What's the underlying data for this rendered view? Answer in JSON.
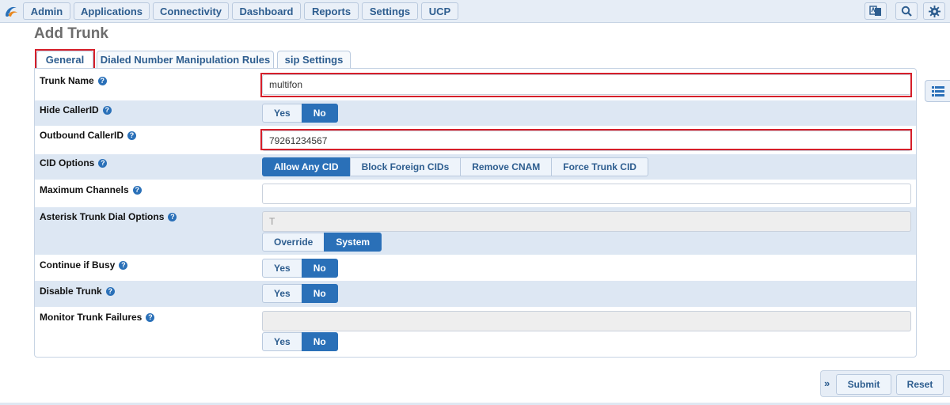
{
  "nav": {
    "items": [
      "Admin",
      "Applications",
      "Connectivity",
      "Dashboard",
      "Reports",
      "Settings",
      "UCP"
    ]
  },
  "page": {
    "title": "Add Trunk"
  },
  "tabs": [
    "General",
    "Dialed Number Manipulation Rules",
    "sip Settings"
  ],
  "form": {
    "trunk_name": {
      "label": "Trunk Name",
      "value": "multifon"
    },
    "hide_callerid": {
      "label": "Hide CallerID",
      "options": [
        "Yes",
        "No"
      ],
      "selected": "No"
    },
    "outbound_callerid": {
      "label": "Outbound CallerID",
      "value": "79261234567"
    },
    "cid_options": {
      "label": "CID Options",
      "options": [
        "Allow Any CID",
        "Block Foreign CIDs",
        "Remove CNAM",
        "Force Trunk CID"
      ],
      "selected": "Allow Any CID"
    },
    "max_channels": {
      "label": "Maximum Channels",
      "value": ""
    },
    "dial_options": {
      "label": "Asterisk Trunk Dial Options",
      "placeholder": "T",
      "options": [
        "Override",
        "System"
      ],
      "selected": "System"
    },
    "continue_busy": {
      "label": "Continue if Busy",
      "options": [
        "Yes",
        "No"
      ],
      "selected": "No"
    },
    "disable_trunk": {
      "label": "Disable Trunk",
      "options": [
        "Yes",
        "No"
      ],
      "selected": "No"
    },
    "monitor_failures": {
      "label": "Monitor Trunk Failures",
      "value": "",
      "options": [
        "Yes",
        "No"
      ],
      "selected": "No"
    }
  },
  "help_glyph": "?",
  "footer": {
    "submit": "Submit",
    "reset": "Reset",
    "expand_glyph": "»"
  },
  "colors": {
    "accent": "#2a70b8",
    "highlight": "#d61f2a",
    "row_alt": "#dde7f3"
  }
}
